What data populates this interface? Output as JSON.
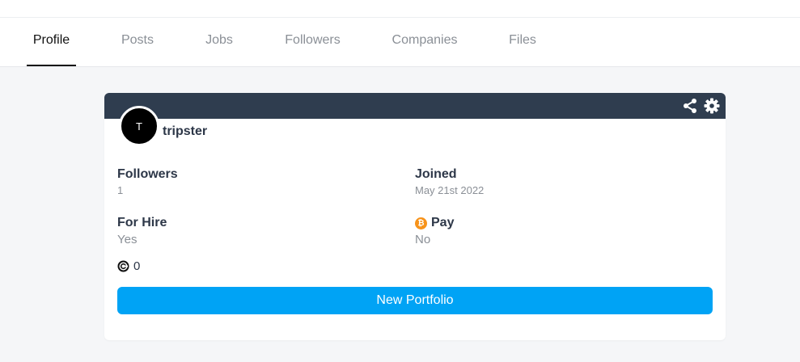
{
  "tabs": [
    {
      "label": "Profile",
      "active": true
    },
    {
      "label": "Posts",
      "active": false
    },
    {
      "label": "Jobs",
      "active": false
    },
    {
      "label": "Followers",
      "active": false
    },
    {
      "label": "Companies",
      "active": false
    },
    {
      "label": "Files",
      "active": false
    }
  ],
  "card": {
    "header_color": "#2f3d4f",
    "icons": {
      "share": "share-icon",
      "settings": "gear-icon"
    },
    "avatar_initial": "T",
    "username": "tripster",
    "followers": {
      "label": "Followers",
      "value": "1"
    },
    "joined": {
      "label": "Joined",
      "value": "May 21st 2022"
    },
    "for_hire": {
      "label": "For Hire",
      "value": "Yes"
    },
    "pay": {
      "label": "Pay",
      "value": "No",
      "icon": "bitcoin-icon"
    },
    "credits": {
      "value": "0",
      "icon": "coin-icon"
    },
    "new_portfolio_label": "New Portfolio",
    "accent_color": "#00a3f5"
  }
}
